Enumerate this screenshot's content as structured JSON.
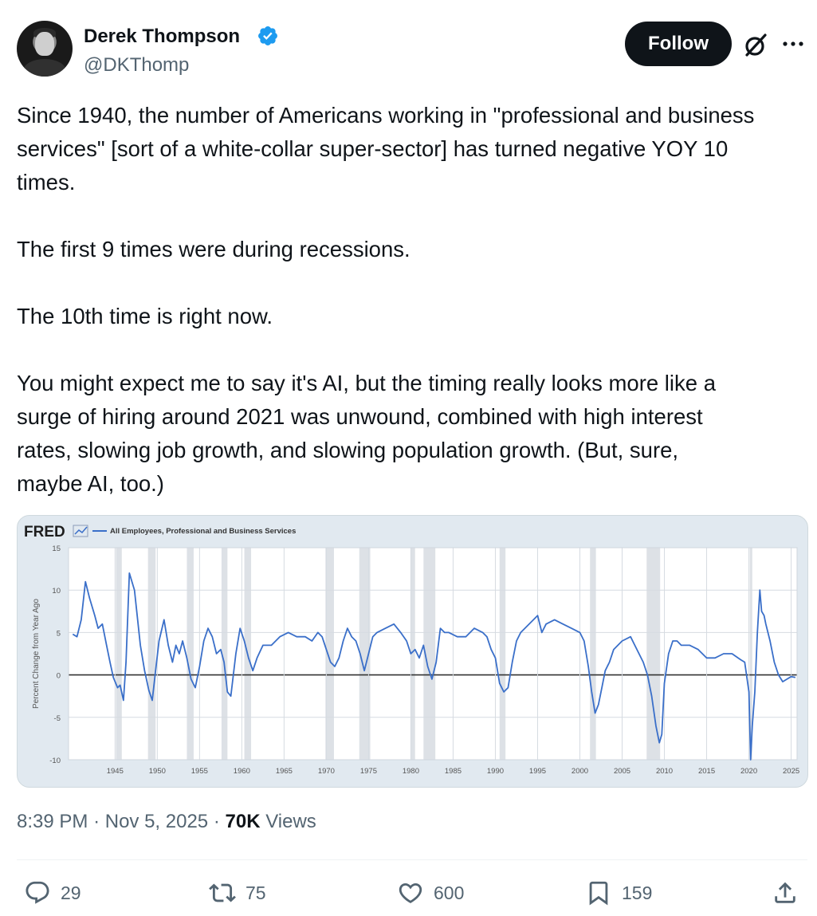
{
  "tweet": {
    "author": {
      "name": "Derek Thompson",
      "handle": "@DKThomp",
      "verified": true,
      "avatar_icon": "profile-photo"
    },
    "follow_label": "Follow",
    "text_lines": [
      "Since 1940, the number of Americans working in \"professional and business",
      "services\" [sort of a white-collar super-sector] has turned negative YOY 10",
      "times.",
      "",
      "The first 9 times were during recessions.",
      "",
      "The 10th time is right now.",
      "",
      "You might expect me to say it's AI, but the timing really looks more like a",
      "surge of hiring around 2021 was unwound, combined with high interest",
      "rates, slowing job growth, and slowing population growth. (But, sure,",
      "maybe AI, too.)"
    ],
    "time": "8:39 PM",
    "date": "Nov 5, 2025",
    "views_count": "70K",
    "views_label": "Views",
    "separator": "·",
    "actions": {
      "replies": "29",
      "reposts": "75",
      "likes": "600",
      "bookmarks": "159"
    },
    "colors": {
      "accent": "#1d9bf0",
      "text": "#0f1419",
      "muted": "#536471",
      "line": "#3a6fc9"
    }
  },
  "chart_data": {
    "type": "line",
    "brand": "FRED",
    "series": [
      {
        "name": "All Employees, Professional and Business Services",
        "x": [
          1940.0,
          1940.5,
          1941.0,
          1941.5,
          1942.0,
          1942.6,
          1943.0,
          1943.5,
          1944.0,
          1944.4,
          1944.8,
          1945.3,
          1945.6,
          1946.0,
          1946.3,
          1946.7,
          1947.3,
          1948.0,
          1948.5,
          1949.0,
          1949.4,
          1949.8,
          1950.2,
          1950.8,
          1951.3,
          1951.8,
          1952.2,
          1952.6,
          1953.0,
          1953.5,
          1954.0,
          1954.5,
          1955.0,
          1955.5,
          1956.0,
          1956.5,
          1957.0,
          1957.5,
          1957.9,
          1958.3,
          1958.7,
          1959.3,
          1959.8,
          1960.3,
          1960.8,
          1961.3,
          1961.8,
          1962.5,
          1963.5,
          1964.5,
          1965.5,
          1966.5,
          1967.5,
          1968.3,
          1969.0,
          1969.5,
          1970.0,
          1970.5,
          1971.0,
          1971.5,
          1972.0,
          1972.5,
          1973.0,
          1973.5,
          1974.0,
          1974.5,
          1975.0,
          1975.5,
          1976.0,
          1977.0,
          1978.0,
          1978.8,
          1979.5,
          1980.0,
          1980.5,
          1981.0,
          1981.5,
          1982.0,
          1982.5,
          1983.0,
          1983.5,
          1984.0,
          1984.5,
          1985.5,
          1986.5,
          1987.5,
          1988.5,
          1989.0,
          1989.5,
          1990.0,
          1990.5,
          1991.0,
          1991.5,
          1992.0,
          1992.5,
          1993.0,
          1994.0,
          1995.0,
          1995.5,
          1996.0,
          1997.0,
          1998.0,
          1999.0,
          2000.0,
          2000.5,
          2001.0,
          2001.4,
          2001.8,
          2002.2,
          2002.6,
          2003.0,
          2003.5,
          2004.0,
          2005.0,
          2006.0,
          2006.5,
          2007.0,
          2007.5,
          2008.0,
          2008.5,
          2009.0,
          2009.4,
          2009.7,
          2010.0,
          2010.5,
          2011.0,
          2011.5,
          2012.0,
          2013.0,
          2014.0,
          2015.0,
          2016.0,
          2017.0,
          2018.0,
          2019.0,
          2019.5,
          2020.0,
          2020.2,
          2020.4,
          2020.7,
          2021.0,
          2021.3,
          2021.5,
          2021.8,
          2022.0,
          2022.5,
          2023.0,
          2023.5,
          2024.0,
          2024.5,
          2025.0,
          2025.5
        ],
        "y": [
          4.8,
          4.5,
          6.5,
          11.0,
          9.0,
          7.0,
          5.5,
          6.0,
          3.5,
          1.5,
          -0.3,
          -1.5,
          -1.2,
          -3.0,
          1.5,
          12.0,
          10.0,
          3.5,
          0.5,
          -1.8,
          -3.0,
          0.5,
          4.0,
          6.5,
          3.5,
          1.5,
          3.5,
          2.5,
          4.0,
          2.0,
          -0.5,
          -1.5,
          1.0,
          4.0,
          5.5,
          4.5,
          2.5,
          3.0,
          1.5,
          -2.0,
          -2.5,
          2.5,
          5.5,
          4.0,
          2.0,
          0.5,
          2.0,
          3.5,
          3.5,
          4.5,
          5.0,
          4.5,
          4.5,
          4.0,
          5.0,
          4.5,
          3.0,
          1.5,
          1.0,
          2.0,
          4.0,
          5.5,
          4.5,
          4.0,
          2.5,
          0.5,
          2.5,
          4.5,
          5.0,
          5.5,
          6.0,
          5.0,
          4.0,
          2.5,
          3.0,
          2.0,
          3.5,
          1.0,
          -0.5,
          1.5,
          5.5,
          5.0,
          5.0,
          4.5,
          4.5,
          5.5,
          5.0,
          4.5,
          3.0,
          2.0,
          -1.0,
          -2.0,
          -1.5,
          1.5,
          4.0,
          5.0,
          6.0,
          7.0,
          5.0,
          6.0,
          6.5,
          6.0,
          5.5,
          5.0,
          4.0,
          1.0,
          -2.0,
          -4.5,
          -3.5,
          -1.5,
          0.5,
          1.5,
          3.0,
          4.0,
          4.5,
          3.5,
          2.5,
          1.5,
          0.0,
          -2.5,
          -6.0,
          -8.0,
          -7.0,
          -1.0,
          2.5,
          4.0,
          4.0,
          3.5,
          3.5,
          3.0,
          2.0,
          2.0,
          2.5,
          2.5,
          1.8,
          1.5,
          -2.0,
          -10.0,
          -6.0,
          -2.0,
          5.0,
          10.0,
          7.5,
          7.0,
          6.0,
          4.0,
          1.5,
          0.0,
          -0.8,
          -0.5,
          -0.2,
          -0.3
        ],
        "color": "#3a6fc9"
      }
    ],
    "recessions": [
      [
        1945.1,
        1945.8
      ],
      [
        1948.9,
        1949.8
      ],
      [
        1953.5,
        1954.3
      ],
      [
        1957.6,
        1958.3
      ],
      [
        1960.3,
        1961.1
      ],
      [
        1969.9,
        1970.9
      ],
      [
        1973.9,
        1975.2
      ],
      [
        1980.0,
        1980.5
      ],
      [
        1981.5,
        1982.9
      ],
      [
        1990.5,
        1991.2
      ],
      [
        2001.2,
        2001.9
      ],
      [
        2007.9,
        2009.5
      ],
      [
        2020.1,
        2020.4
      ]
    ],
    "xlim": [
      1939.5,
      2025.7
    ],
    "ylim": [
      -10,
      15
    ],
    "x_ticks": [
      1945,
      1950,
      1955,
      1960,
      1965,
      1970,
      1975,
      1980,
      1985,
      1990,
      1995,
      2000,
      2005,
      2010,
      2015,
      2020,
      2025
    ],
    "y_ticks": [
      -10,
      -5,
      0,
      5,
      10,
      15
    ],
    "ylabel": "Percent Change from Year Ago",
    "xlabel": "",
    "grid": true,
    "legend_position": "top-left"
  }
}
